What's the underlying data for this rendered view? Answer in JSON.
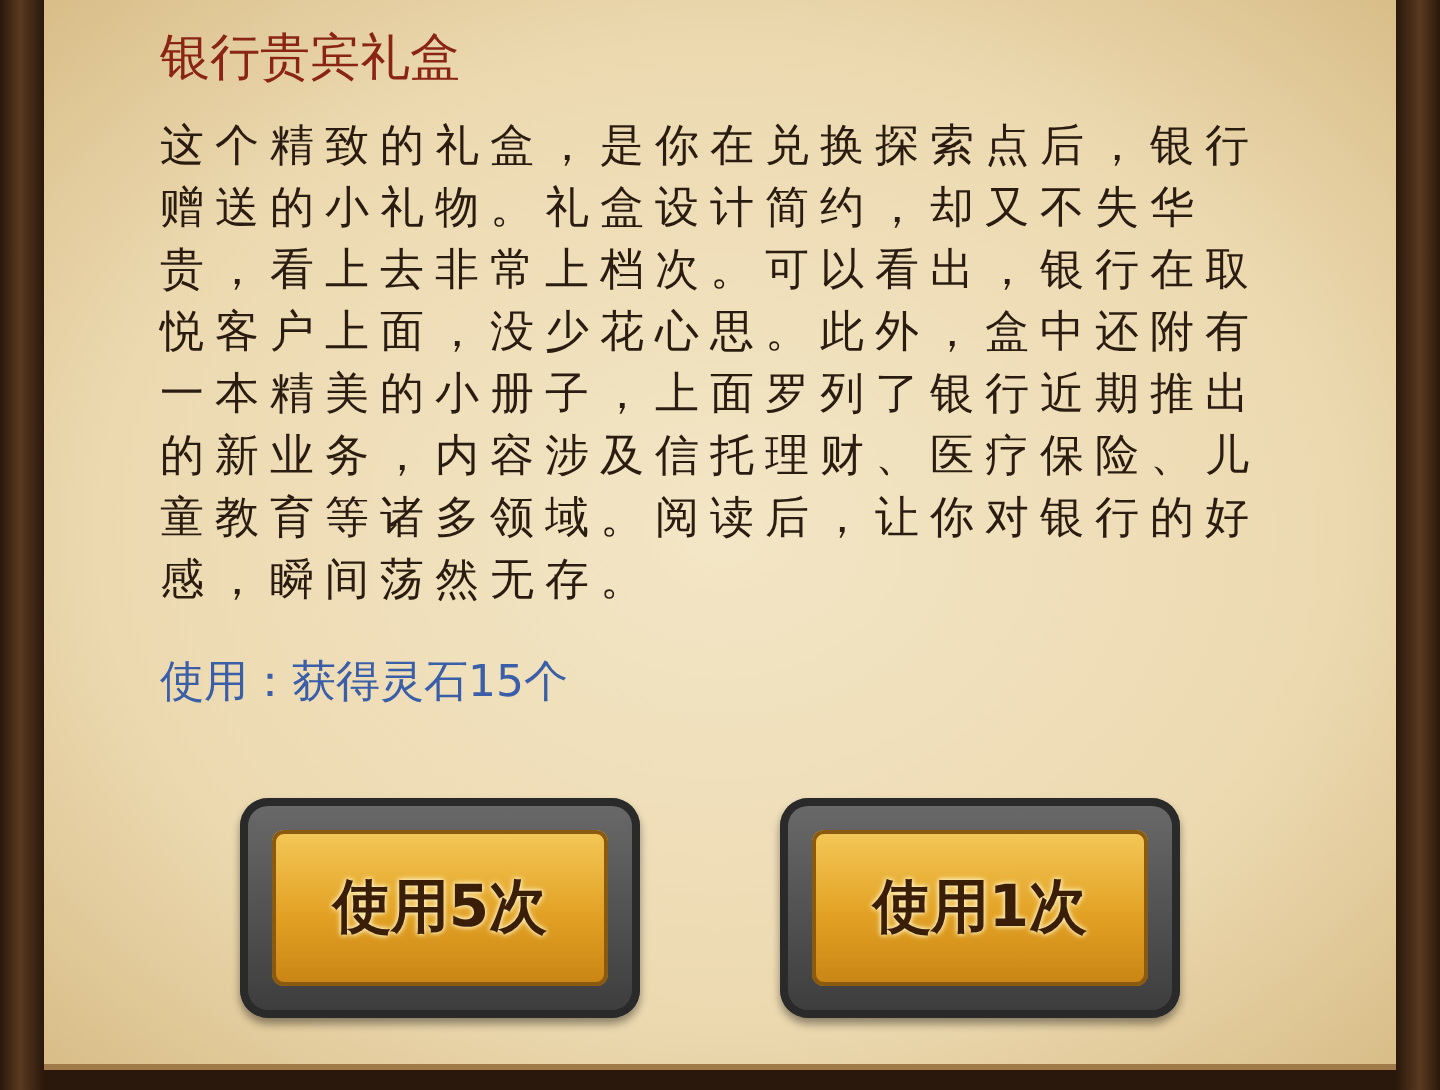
{
  "title": "银行贵宾礼盒",
  "description": "这个精致的礼盒，是你在兑换探索点后，银行赠送的小礼物。礼盒设计简约，却又不失华贵，看上去非常上档次。可以看出，银行在取悦客户上面，没少花心思。此外，盒中还附有一本精美的小册子，上面罗列了银行近期推出的新业务，内容涉及信托理财、医疗保险、儿童教育等诸多领域。阅读后，让你对银行的好感，瞬间荡然无存。",
  "usage": "使用：获得灵石15个",
  "buttons": [
    "使用5次",
    "使用1次"
  ]
}
